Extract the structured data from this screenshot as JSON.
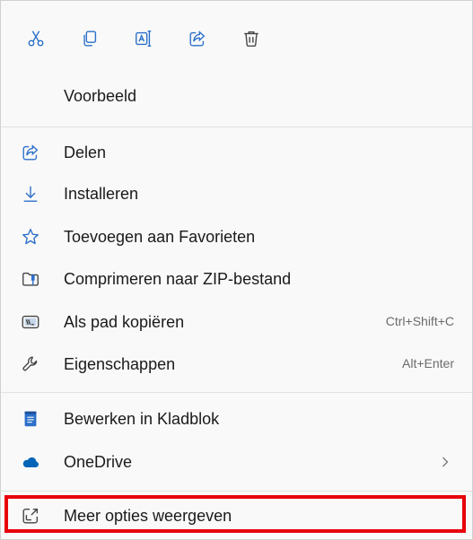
{
  "toolbar": {
    "buttons": [
      {
        "icon": "cut-icon"
      },
      {
        "icon": "copy-icon"
      },
      {
        "icon": "rename-icon"
      },
      {
        "icon": "share-icon"
      },
      {
        "icon": "delete-icon"
      }
    ]
  },
  "menu": {
    "preview_label": "Voorbeeld",
    "share_label": "Delen",
    "install_label": "Installeren",
    "favorites_label": "Toevoegen aan Favorieten",
    "zip_label": "Comprimeren naar ZIP-bestand",
    "copypath_label": "Als pad kopiëren",
    "copypath_shortcut": "Ctrl+Shift+C",
    "properties_label": "Eigenschappen",
    "properties_shortcut": "Alt+Enter",
    "notepad_label": "Bewerken in Kladblok",
    "onedrive_label": "OneDrive",
    "more_label": "Meer opties weergeven"
  },
  "colors": {
    "accent": "#0067c0",
    "highlight": "#e8000b",
    "onedrive": "#0364b8",
    "notepad": "#2b6fc9"
  }
}
